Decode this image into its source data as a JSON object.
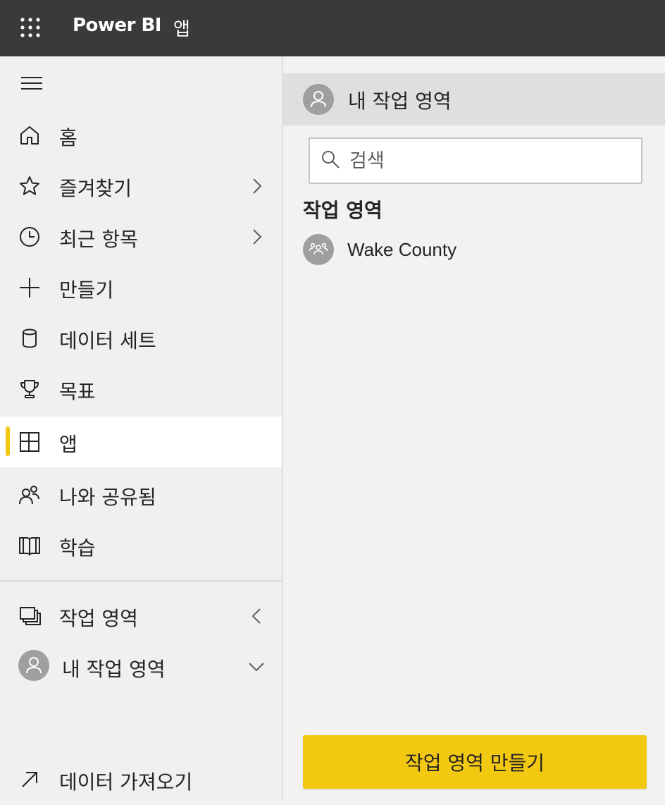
{
  "header": {
    "app_title": "Power BI",
    "page_title": "앱"
  },
  "nav": {
    "items": [
      {
        "label": "홈",
        "icon": "home-icon"
      },
      {
        "label": "즐겨찾기",
        "icon": "star-icon",
        "chevron": "chevron-right-icon"
      },
      {
        "label": "최근 항목",
        "icon": "clock-icon",
        "chevron": "chevron-right-icon"
      },
      {
        "label": "만들기",
        "icon": "plus-icon"
      },
      {
        "label": "데이터 세트",
        "icon": "database-icon"
      },
      {
        "label": "목표",
        "icon": "trophy-icon"
      },
      {
        "label": "앱",
        "icon": "apps-icon",
        "active": true
      },
      {
        "label": "나와 공유됨",
        "icon": "shared-people-icon"
      },
      {
        "label": "학습",
        "icon": "book-icon"
      }
    ],
    "workspaces": {
      "label": "작업 영역",
      "icon": "workspaces-icon",
      "chevron": "chevron-left-icon"
    },
    "my_workspace": {
      "label": "내 작업 영역",
      "icon": "avatar-icon",
      "chevron": "chevron-down-icon"
    },
    "get_data": {
      "label": "데이터 가져오기",
      "icon": "arrow-up-right-icon"
    }
  },
  "panel": {
    "header_label": "내 작업 영역",
    "search_placeholder": "검색",
    "section_title": "작업 영역",
    "workspaces": [
      {
        "name": "Wake County",
        "icon": "group-icon"
      }
    ],
    "create_button": "작업 영역 만들기"
  },
  "colors": {
    "topbar": "#3b3a39",
    "accent": "#f2c811",
    "nav_bg": "#f1f0ee",
    "active_bg": "#ffffff",
    "avatar": "#a19f9d"
  }
}
